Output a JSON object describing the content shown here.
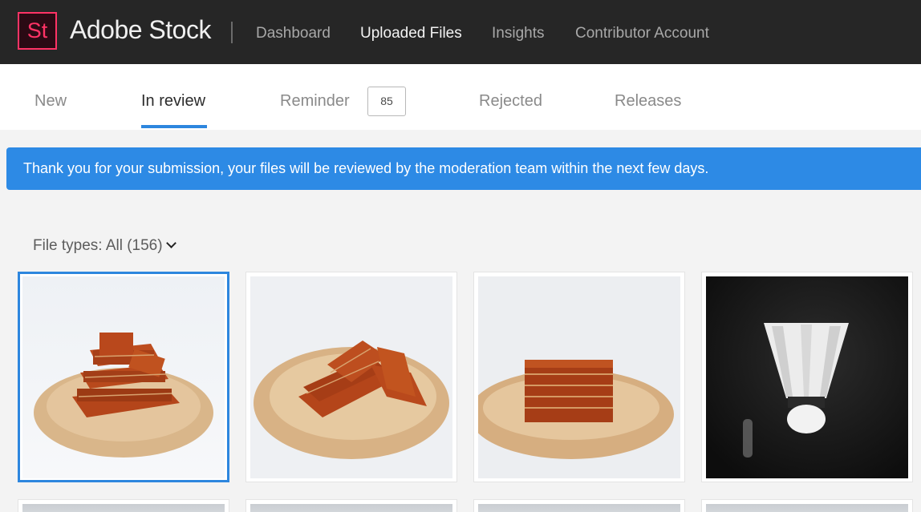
{
  "header": {
    "logo_text": "St",
    "brand": "Adobe Stock",
    "nav": [
      {
        "label": "Dashboard",
        "active": false
      },
      {
        "label": "Uploaded Files",
        "active": true
      },
      {
        "label": "Insights",
        "active": false
      },
      {
        "label": "Contributor Account",
        "active": false
      }
    ]
  },
  "tabs": [
    {
      "label": "New",
      "active": false
    },
    {
      "label": "In review",
      "active": true
    },
    {
      "label": "Reminder",
      "active": false,
      "count": "85"
    },
    {
      "label": "Rejected",
      "active": false
    },
    {
      "label": "Releases",
      "active": false
    }
  ],
  "banner": {
    "message": "Thank you for your submission, your files will be reviewed by the moderation team within the next few days."
  },
  "filter": {
    "label": "File types: All (156)"
  },
  "grid": {
    "items": [
      {
        "subject": "layered cake on wooden plate",
        "selected": true
      },
      {
        "subject": "layered cake slices on wooden plate",
        "selected": false
      },
      {
        "subject": "layered cake stack on wooden plate",
        "selected": false
      },
      {
        "subject": "badminton shuttlecock on black",
        "selected": false
      }
    ]
  },
  "colors": {
    "accent": "#2d86de",
    "banner": "#2d8ae5",
    "logo": "#ff3366",
    "topbar": "#262626"
  }
}
